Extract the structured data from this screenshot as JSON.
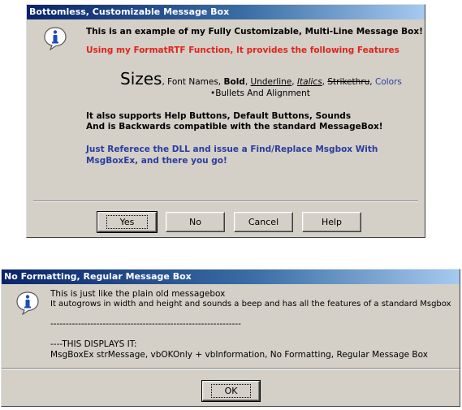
{
  "dialog1": {
    "title": "Bottomless, Customizable Message Box",
    "icon": "info-icon",
    "line1": "This is an example of my Fully Customizable, Multi-Line Message Box!",
    "line2": "Using my FormatRTF Function, It provides the following Features",
    "features": {
      "sizes": "Sizes",
      "sep1": ", Font Names, ",
      "bold": "Bold",
      "sep2": ", ",
      "underline": "Underline",
      "sep3": ", ",
      "italics": "Italics",
      "sep4": ", ",
      "strikethru": "Strikethru",
      "sep5": ", ",
      "colors": "Colors"
    },
    "bullets": "•Bullets And Alignment",
    "support1": "It also supports Help Buttons, Default Buttons, Sounds",
    "support2": "And is Backwards compatible with the standard MessageBox!",
    "dll1": "Just Referece the DLL and issue a Find/Replace Msgbox With",
    "dll2": "MsgBoxEx, and there you go!",
    "buttons": {
      "yes": "Yes",
      "no": "No",
      "cancel": "Cancel",
      "help": "Help"
    }
  },
  "dialog2": {
    "title": "No Formatting, Regular Message Box",
    "icon": "info-icon",
    "line1": "This is just like the plain old messagebox",
    "line2": "It autogrows in width and height and sounds a beep and has all the features of a standard Msgbox",
    "dashes": "--------------------------------------------------------------",
    "line3": "----THIS DISPLAYS IT:",
    "line4": "MsgBoxEx strMessage, vbOKOnly + vbInformation, No Formatting, Regular Message Box",
    "buttons": {
      "ok": "OK"
    }
  },
  "colors": {
    "title_start": "#0a246a",
    "title_end": "#a6caf0",
    "face": "#d4d0c8",
    "red_text": "#e0241b",
    "blue_text": "#2a3c9e"
  }
}
